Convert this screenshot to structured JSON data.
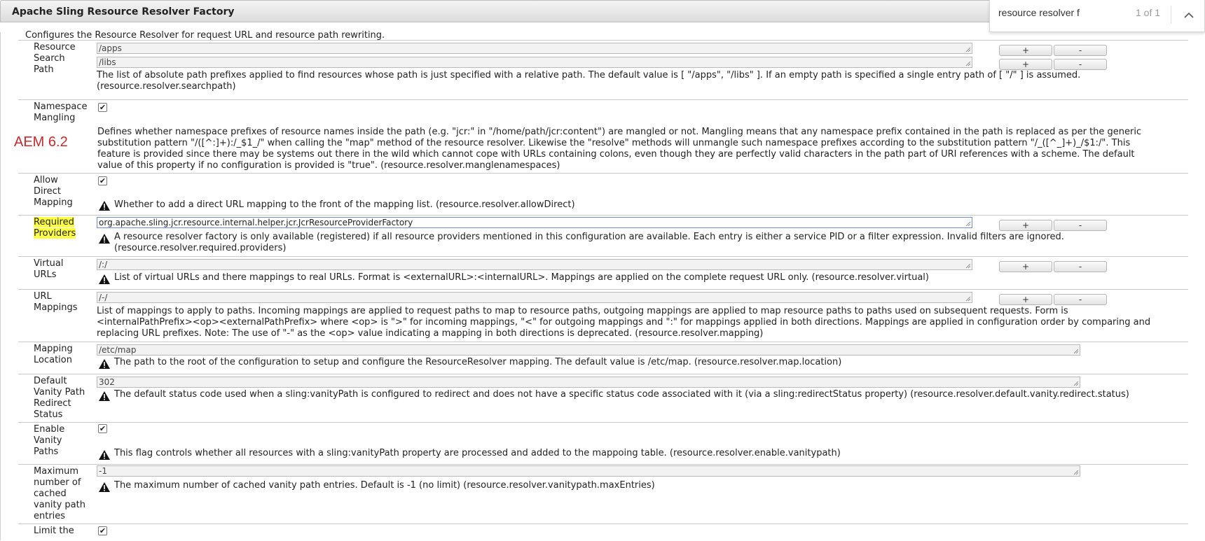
{
  "panel": {
    "title": "Apache Sling Resource Resolver Factory",
    "description": "Configures the Resource Resolver for request URL and resource path rewriting."
  },
  "find": {
    "query": "resource resolver f",
    "count": "1 of 1"
  },
  "annotation": "AEM 6.2",
  "buttons": {
    "add": "+",
    "remove": "-"
  },
  "rows": {
    "search_path": {
      "label": [
        "Resource",
        "Search",
        "Path"
      ],
      "values": [
        "/apps",
        "/libs"
      ],
      "help": [
        "The list of absolute path prefixes applied to find resources whose path is just specified with a relative path. The default value is [ \"/apps\", \"/libs\" ]. If an empty path is specified a single entry path of [ \"/\" ] is assumed.",
        "(resource.resolver.searchpath)"
      ]
    },
    "namespace_mangling": {
      "label": [
        "Namespace",
        "Mangling"
      ],
      "checked": true,
      "help": [
        "Defines whether namespace prefixes of resource names inside the path (e.g. \"jcr:\" in \"/home/path/jcr:content\") are mangled or not. Mangling means that any namespace prefix contained in the path is replaced as per the generic",
        "substitution pattern \"/([^:]+):/_$1_/\" when calling the \"map\" method of the resource resolver. Likewise the \"resolve\" methods will unmangle such namespace prefixes according to the substitution pattern \"/_([^_]+)_/$1:/\". This",
        "feature is provided since there may be systems out there in the wild which cannot cope with URLs containing colons, even though they are perfectly valid characters in the path part of URI references with a scheme. The default",
        "value of this property if no configuration is provided is \"true\". (resource.resolver.manglenamespaces)"
      ]
    },
    "allow_direct": {
      "label": [
        "Allow",
        "Direct",
        "Mapping"
      ],
      "checked": true,
      "help": "Whether to add a direct URL mapping to the front of the mapping list. (resource.resolver.allowDirect)"
    },
    "required_providers": {
      "label": [
        "Required",
        "Providers"
      ],
      "value": "org.apache.sling.jcr.resource.internal.helper.jcr.JcrResourceProviderFactory",
      "help": [
        "A resource resolver factory is only available (registered) if all resource providers mentioned in this configuration are available. Each entry is either a service PID or a filter expression. Invalid filters are ignored.",
        "(resource.resolver.required.providers)"
      ]
    },
    "virtual_urls": {
      "label": [
        "Virtual",
        "URLs"
      ],
      "value": "/:/",
      "help": "List of virtual URLs and there mappings to real URLs. Format is <externalURL>:<internalURL>. Mappings are applied on the complete request URL only. (resource.resolver.virtual)"
    },
    "url_mappings": {
      "label": [
        "URL",
        "Mappings"
      ],
      "value": "/-/",
      "help": [
        "List of mappings to apply to paths. Incoming mappings are applied to request paths to map to resource paths, outgoing mappings are applied to map resource paths to paths used on subsequent requests. Form is",
        "<internalPathPrefix><op><externalPathPrefix> where <op> is \">\" for incoming mappings, \"<\" for outgoing mappings and \":\" for mappings applied in both directions. Mappings are applied in configuration order by comparing and",
        "replacing URL prefixes. Note: The use of \"-\" as the <op> value indicating a mapping in both directions is deprecated. (resource.resolver.mapping)"
      ]
    },
    "mapping_location": {
      "label": [
        "Mapping",
        "Location"
      ],
      "value": "/etc/map",
      "help": "The path to the root of the configuration to setup and configure the ResourceResolver mapping. The default value is /etc/map. (resource.resolver.map.location)"
    },
    "vanity_redirect": {
      "label": [
        "Default",
        "Vanity Path",
        "Redirect",
        "Status"
      ],
      "value": "302",
      "help": "The default status code used when a sling:vanityPath is configured to redirect and does not have a specific status code associated with it (via a sling:redirectStatus property) (resource.resolver.default.vanity.redirect.status)"
    },
    "enable_vanity": {
      "label": [
        "Enable",
        "Vanity",
        "Paths"
      ],
      "checked": true,
      "help": "This flag controls whether all resources with a sling:vanityPath property are processed and added to the mappoing table. (resource.resolver.enable.vanitypath)"
    },
    "max_vanity": {
      "label": [
        "Maximum",
        "number of",
        "cached",
        "vanity path",
        "entries"
      ],
      "value": "-1",
      "help": "The maximum number of cached vanity path entries. Default is -1 (no limit) (resource.resolver.vanitypath.maxEntries)"
    },
    "limit": {
      "label": [
        "Limit the"
      ],
      "checked": true
    }
  }
}
